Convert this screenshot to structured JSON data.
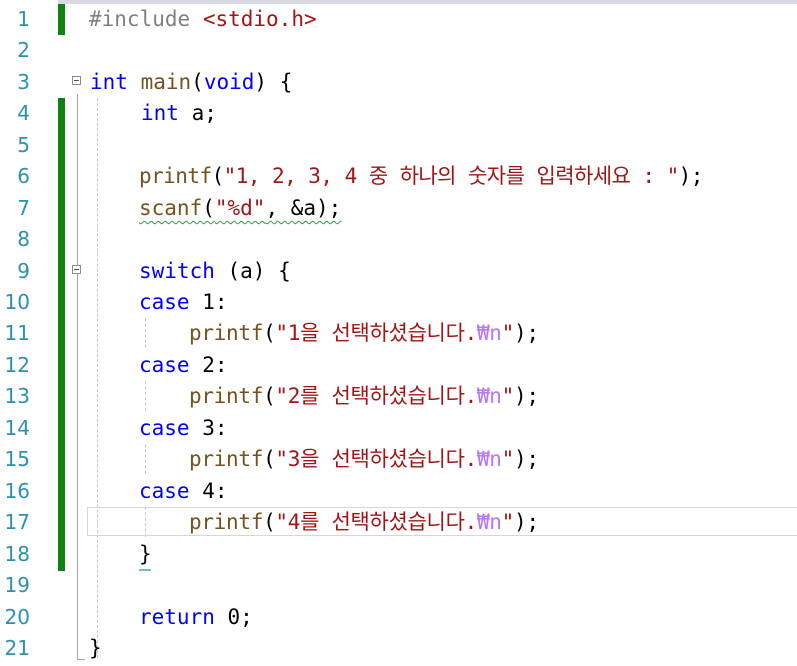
{
  "editor": {
    "line_numbers": [
      "1",
      "2",
      "3",
      "4",
      "5",
      "6",
      "7",
      "8",
      "9",
      "10",
      "11",
      "12",
      "13",
      "14",
      "15",
      "16",
      "17",
      "18",
      "19",
      "20",
      "21"
    ],
    "lines": {
      "l1": {
        "directive": "#include",
        "space": " ",
        "header": "<stdio.h>"
      },
      "l3": {
        "kw_int": "int",
        "space1": " ",
        "fn_main": "main",
        "paren_open": "(",
        "kw_void": "void",
        "rest": ") {"
      },
      "l4": {
        "kw_int": "int",
        "rest": " a;"
      },
      "l6": {
        "fn_printf": "printf",
        "paren_open": "(",
        "string": "\"1, 2, 3, 4 중 하나의 숫자를 입력하세요 : \"",
        "rest": ");"
      },
      "l7": {
        "fn_scanf": "scanf",
        "paren_open": "(",
        "string": "\"%d\"",
        "rest": ", &a);"
      },
      "l9": {
        "kw_switch": "switch",
        "rest": " (a) {"
      },
      "l10": {
        "kw_case": "case",
        "rest": " 1:"
      },
      "l11": {
        "fn_printf": "printf",
        "paren_open": "(",
        "string_a": "\"1을 선택하셨습니다.",
        "escape": "₩n",
        "string_b": "\"",
        "rest": ");"
      },
      "l12": {
        "kw_case": "case",
        "rest": " 2:"
      },
      "l13": {
        "fn_printf": "printf",
        "paren_open": "(",
        "string_a": "\"2를 선택하셨습니다.",
        "escape": "₩n",
        "string_b": "\"",
        "rest": ");"
      },
      "l14": {
        "kw_case": "case",
        "rest": " 3:"
      },
      "l15": {
        "fn_printf": "printf",
        "paren_open": "(",
        "string_a": "\"3을 선택하셨습니다.",
        "escape": "₩n",
        "string_b": "\"",
        "rest": ");"
      },
      "l16": {
        "kw_case": "case",
        "rest": " 4:"
      },
      "l17": {
        "fn_printf": "printf",
        "paren_open": "(",
        "string_a": "\"4를 선택하셨습니다.",
        "escape": "₩n",
        "string_b": "\"",
        "rest": ");"
      },
      "l18": {
        "brace": "}"
      },
      "l20": {
        "kw_return": "return",
        "rest": " 0;"
      },
      "l21": {
        "brace": "}"
      }
    },
    "colors": {
      "line_number": "#2b91af",
      "keyword": "#0000ff",
      "function": "#74531f",
      "string": "#a31515",
      "escape": "#b776fb",
      "preprocessor": "#808080",
      "change_bar": "#108010",
      "squiggle": "#2ea043"
    },
    "fold_icons": [
      "collapse-main-icon",
      "collapse-switch-icon"
    ]
  }
}
